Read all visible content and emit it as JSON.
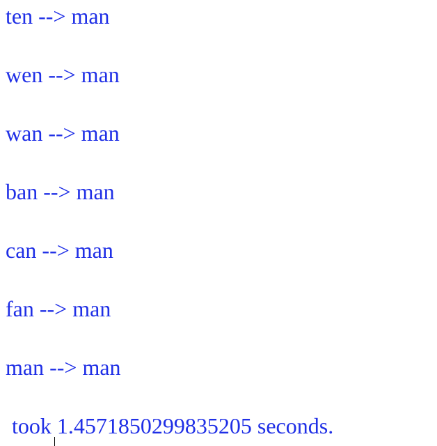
{
  "output": {
    "lines": [
      "ten --> man",
      "wen --> man",
      "wan --> man",
      "ban --> man",
      "can --> man",
      "fan --> man",
      "man --> man"
    ],
    "timing": "took 1.4571850299835205 seconds."
  },
  "colors": {
    "text": "#1f2fe6",
    "background": "#ffffff"
  }
}
